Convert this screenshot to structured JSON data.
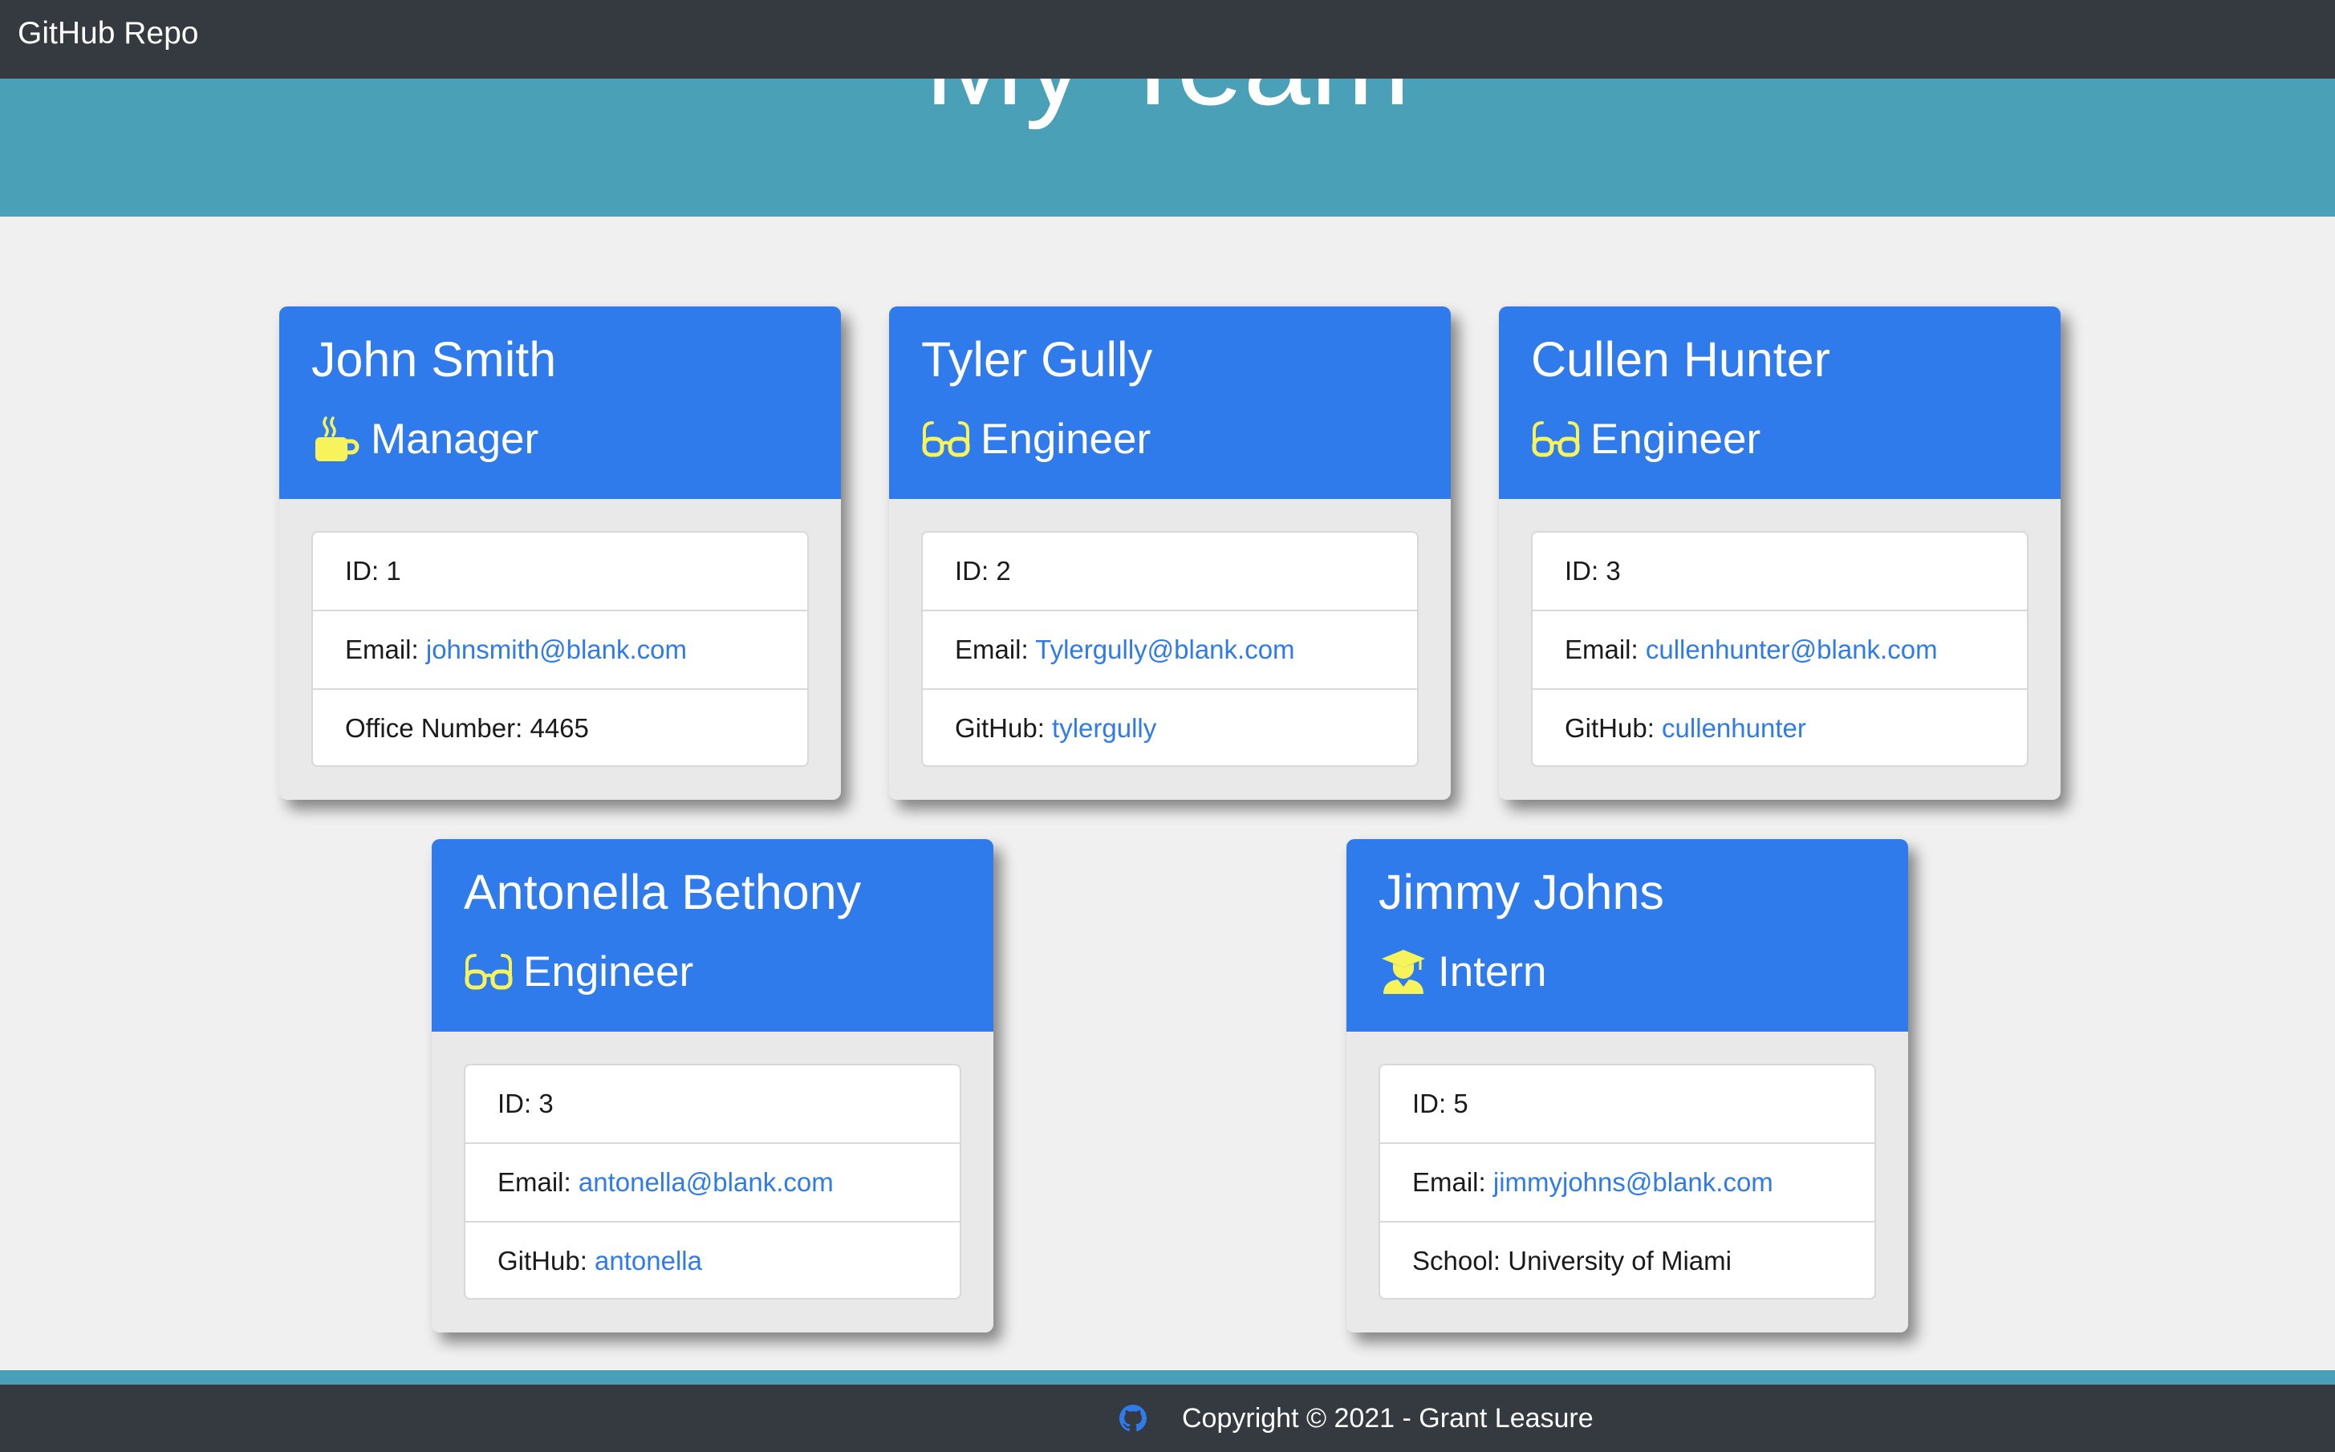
{
  "navbar": {
    "brand": "GitHub Repo"
  },
  "hero": {
    "title": "My Team"
  },
  "employees": [
    {
      "name": "John Smith",
      "role": "Manager",
      "icon": "coffee-mug-icon",
      "id_label": "ID: ",
      "id": "1",
      "email_label": "Email: ",
      "email": "johnsmith@blank.com",
      "extra_label": "Office Number: ",
      "extra_value": "4465"
    },
    {
      "name": "Tyler Gully",
      "role": "Engineer",
      "icon": "glasses-icon",
      "id_label": "ID: ",
      "id": "2",
      "email_label": "Email: ",
      "email": "Tylergully@blank.com",
      "extra_label": "GitHub: ",
      "extra_value": "tylergully"
    },
    {
      "name": "Cullen Hunter",
      "role": "Engineer",
      "icon": "glasses-icon",
      "id_label": "ID: ",
      "id": "3",
      "email_label": "Email: ",
      "email": "cullenhunter@blank.com",
      "extra_label": "GitHub: ",
      "extra_value": "cullenhunter"
    },
    {
      "name": "Antonella Bethony",
      "role": "Engineer",
      "icon": "glasses-icon",
      "id_label": "ID: ",
      "id": "3",
      "email_label": "Email: ",
      "email": "antonella@blank.com",
      "extra_label": "GitHub: ",
      "extra_value": "antonella"
    },
    {
      "name": "Jimmy Johns",
      "role": "Intern",
      "icon": "graduate-icon",
      "id_label": "ID: ",
      "id": "5",
      "email_label": "Email: ",
      "email": "jimmyjohns@blank.com",
      "extra_label": "School: ",
      "extra_value": "University of Miami"
    }
  ],
  "footer": {
    "copyright": "Copyright © 2021 - Grant Leasure",
    "icon": "github-icon"
  },
  "colors": {
    "navbar": "#343a40",
    "hero": "#4aa0b6",
    "card_header": "#2f7bec",
    "link": "#2f7bec",
    "role_icon": "#f7f35a",
    "background": "#f0f0f0"
  }
}
